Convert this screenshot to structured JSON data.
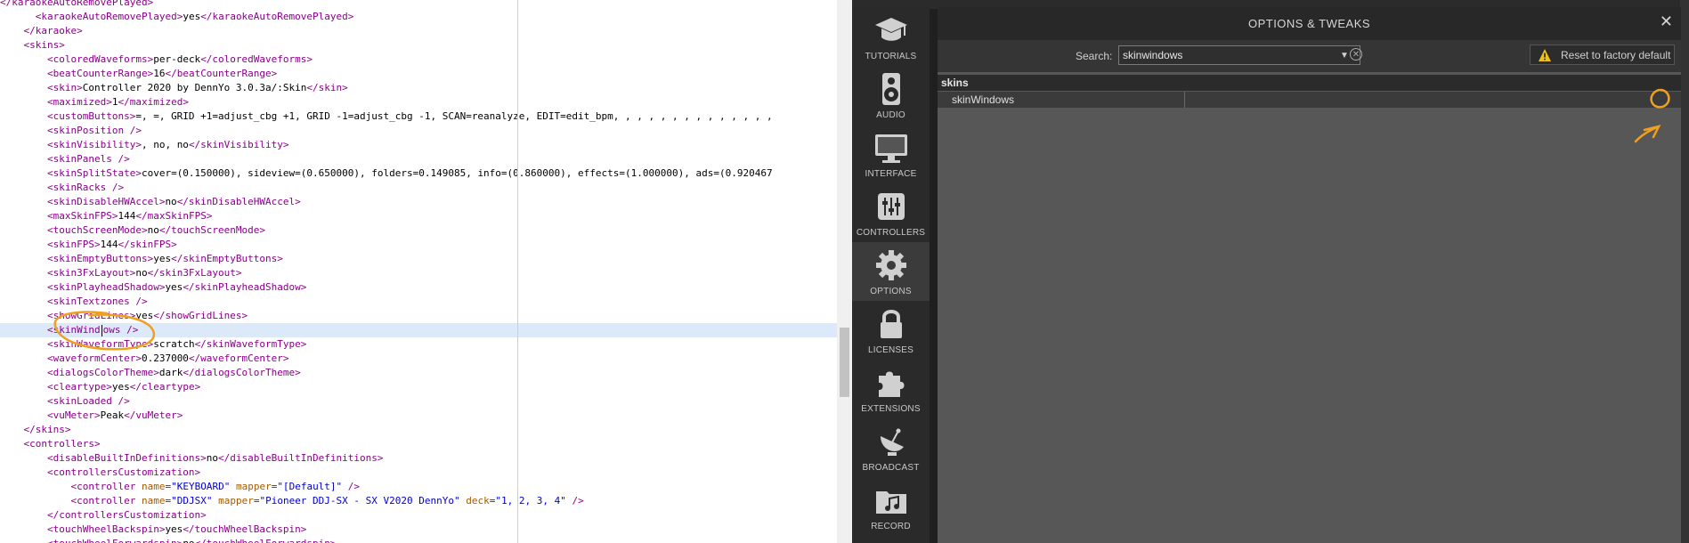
{
  "editor": {
    "lines": [
      [
        {
          "c": "t",
          "s": "</karaokeAutoRemovePlayed>"
        }
      ],
      [
        {
          "c": "x",
          "s": "      "
        },
        {
          "c": "t",
          "s": "<karaokeAutoRemovePlayed>"
        },
        {
          "c": "x",
          "s": "yes"
        },
        {
          "c": "t",
          "s": "</karaokeAutoRemovePlayed>"
        }
      ],
      [
        {
          "c": "x",
          "s": "    "
        },
        {
          "c": "t",
          "s": "</karaoke>"
        }
      ],
      [
        {
          "c": "x",
          "s": "    "
        },
        {
          "c": "t",
          "s": "<skins>"
        }
      ],
      [
        {
          "c": "x",
          "s": "        "
        },
        {
          "c": "t",
          "s": "<coloredWaveforms>"
        },
        {
          "c": "x",
          "s": "per-deck"
        },
        {
          "c": "t",
          "s": "</coloredWaveforms>"
        }
      ],
      [
        {
          "c": "x",
          "s": "        "
        },
        {
          "c": "t",
          "s": "<beatCounterRange>"
        },
        {
          "c": "x",
          "s": "16"
        },
        {
          "c": "t",
          "s": "</beatCounterRange>"
        }
      ],
      [
        {
          "c": "x",
          "s": "        "
        },
        {
          "c": "t",
          "s": "<skin>"
        },
        {
          "c": "x",
          "s": "Controller 2020 by DennYo 3.0.3a/:Skin"
        },
        {
          "c": "t",
          "s": "</skin>"
        }
      ],
      [
        {
          "c": "x",
          "s": "        "
        },
        {
          "c": "t",
          "s": "<maximized>"
        },
        {
          "c": "x",
          "s": "1"
        },
        {
          "c": "t",
          "s": "</maximized>"
        }
      ],
      [
        {
          "c": "x",
          "s": "        "
        },
        {
          "c": "t",
          "s": "<customButtons>"
        },
        {
          "c": "x",
          "s": "=, =, GRID +1=adjust_cbg +1, GRID -1=adjust_cbg -1, SCAN=reanalyze, EDIT=edit_bpm, , , , , , , , , , , , , ,"
        }
      ],
      [
        {
          "c": "x",
          "s": "        "
        },
        {
          "c": "t",
          "s": "<skinPosition />"
        }
      ],
      [
        {
          "c": "x",
          "s": "        "
        },
        {
          "c": "t",
          "s": "<skinVisibility>"
        },
        {
          "c": "x",
          "s": ", no, no"
        },
        {
          "c": "t",
          "s": "</skinVisibility>"
        }
      ],
      [
        {
          "c": "x",
          "s": "        "
        },
        {
          "c": "t",
          "s": "<skinPanels />"
        }
      ],
      [
        {
          "c": "x",
          "s": "        "
        },
        {
          "c": "t",
          "s": "<skinSplitState>"
        },
        {
          "c": "x",
          "s": "cover=(0.150000), sideview=(0.650000), folders=0.149085, info=(0.860000), effects=(1.000000), ads=(0.920467"
        }
      ],
      [
        {
          "c": "x",
          "s": "        "
        },
        {
          "c": "t",
          "s": "<skinRacks />"
        }
      ],
      [
        {
          "c": "x",
          "s": "        "
        },
        {
          "c": "t",
          "s": "<skinDisableHWAccel>"
        },
        {
          "c": "x",
          "s": "no"
        },
        {
          "c": "t",
          "s": "</skinDisableHWAccel>"
        }
      ],
      [
        {
          "c": "x",
          "s": "        "
        },
        {
          "c": "t",
          "s": "<maxSkinFPS>"
        },
        {
          "c": "x",
          "s": "144"
        },
        {
          "c": "t",
          "s": "</maxSkinFPS>"
        }
      ],
      [
        {
          "c": "x",
          "s": "        "
        },
        {
          "c": "t",
          "s": "<touchScreenMode>"
        },
        {
          "c": "x",
          "s": "no"
        },
        {
          "c": "t",
          "s": "</touchScreenMode>"
        }
      ],
      [
        {
          "c": "x",
          "s": "        "
        },
        {
          "c": "t",
          "s": "<skinFPS>"
        },
        {
          "c": "x",
          "s": "144"
        },
        {
          "c": "t",
          "s": "</skinFPS>"
        }
      ],
      [
        {
          "c": "x",
          "s": "        "
        },
        {
          "c": "t",
          "s": "<skinEmptyButtons>"
        },
        {
          "c": "x",
          "s": "yes"
        },
        {
          "c": "t",
          "s": "</skinEmptyButtons>"
        }
      ],
      [
        {
          "c": "x",
          "s": "        "
        },
        {
          "c": "t",
          "s": "<skin3FxLayout>"
        },
        {
          "c": "x",
          "s": "no"
        },
        {
          "c": "t",
          "s": "</skin3FxLayout>"
        }
      ],
      [
        {
          "c": "x",
          "s": "        "
        },
        {
          "c": "t",
          "s": "<skinPlayheadShadow>"
        },
        {
          "c": "x",
          "s": "yes"
        },
        {
          "c": "t",
          "s": "</skinPlayheadShadow>"
        }
      ],
      [
        {
          "c": "x",
          "s": "        "
        },
        {
          "c": "t",
          "s": "<skinTextzones />"
        }
      ],
      [
        {
          "c": "x",
          "s": "        "
        },
        {
          "c": "t",
          "s": "<showGridLines>"
        },
        {
          "c": "x",
          "s": "yes"
        },
        {
          "c": "t",
          "s": "</showGridLines>"
        }
      ],
      [
        {
          "c": "x",
          "s": "        "
        },
        {
          "c": "t",
          "s": "<skinWind"
        },
        {
          "c": "caret",
          "s": ""
        },
        {
          "c": "t",
          "s": "ows />"
        }
      ],
      [
        {
          "c": "x",
          "s": "        "
        },
        {
          "c": "t",
          "s": "<skinWaveformType>"
        },
        {
          "c": "x",
          "s": "scratch"
        },
        {
          "c": "t",
          "s": "</skinWaveformType>"
        }
      ],
      [
        {
          "c": "x",
          "s": "        "
        },
        {
          "c": "t",
          "s": "<waveformCenter>"
        },
        {
          "c": "x",
          "s": "0.237000"
        },
        {
          "c": "t",
          "s": "</waveformCenter>"
        }
      ],
      [
        {
          "c": "x",
          "s": "        "
        },
        {
          "c": "t",
          "s": "<dialogsColorTheme>"
        },
        {
          "c": "x",
          "s": "dark"
        },
        {
          "c": "t",
          "s": "</dialogsColorTheme>"
        }
      ],
      [
        {
          "c": "x",
          "s": "        "
        },
        {
          "c": "t",
          "s": "<cleartype>"
        },
        {
          "c": "x",
          "s": "yes"
        },
        {
          "c": "t",
          "s": "</cleartype>"
        }
      ],
      [
        {
          "c": "x",
          "s": "        "
        },
        {
          "c": "t",
          "s": "<skinLoaded />"
        }
      ],
      [
        {
          "c": "x",
          "s": "        "
        },
        {
          "c": "t",
          "s": "<vuMeter>"
        },
        {
          "c": "x",
          "s": "Peak"
        },
        {
          "c": "t",
          "s": "</vuMeter>"
        }
      ],
      [
        {
          "c": "x",
          "s": "    "
        },
        {
          "c": "t",
          "s": "</skins>"
        }
      ],
      [
        {
          "c": "x",
          "s": "    "
        },
        {
          "c": "t",
          "s": "<controllers>"
        }
      ],
      [
        {
          "c": "x",
          "s": "        "
        },
        {
          "c": "t",
          "s": "<disableBuiltInDefinitions>"
        },
        {
          "c": "x",
          "s": "no"
        },
        {
          "c": "t",
          "s": "</disableBuiltInDefinitions>"
        }
      ],
      [
        {
          "c": "x",
          "s": "        "
        },
        {
          "c": "t",
          "s": "<controllersCustomization>"
        }
      ],
      [
        {
          "c": "x",
          "s": "            "
        },
        {
          "c": "t",
          "s": "<controller "
        },
        {
          "c": "an",
          "s": "name"
        },
        {
          "c": "t",
          "s": "="
        },
        {
          "c": "av",
          "s": "\"KEYBOARD\""
        },
        {
          "c": "x",
          "s": " "
        },
        {
          "c": "an",
          "s": "mapper"
        },
        {
          "c": "t",
          "s": "="
        },
        {
          "c": "av",
          "s": "\"[Default]\""
        },
        {
          "c": "t",
          "s": " />"
        }
      ],
      [
        {
          "c": "x",
          "s": "            "
        },
        {
          "c": "t",
          "s": "<controller "
        },
        {
          "c": "an",
          "s": "name"
        },
        {
          "c": "t",
          "s": "="
        },
        {
          "c": "av",
          "s": "\"DDJSX\""
        },
        {
          "c": "x",
          "s": " "
        },
        {
          "c": "an",
          "s": "mapper"
        },
        {
          "c": "t",
          "s": "="
        },
        {
          "c": "av",
          "s": "\"Pioneer DDJ-SX - SX V2020 DennYo\""
        },
        {
          "c": "x",
          "s": " "
        },
        {
          "c": "an",
          "s": "deck"
        },
        {
          "c": "t",
          "s": "="
        },
        {
          "c": "av",
          "s": "\"1, 2, 3, 4\""
        },
        {
          "c": "t",
          "s": " />"
        }
      ],
      [
        {
          "c": "x",
          "s": "        "
        },
        {
          "c": "t",
          "s": "</controllersCustomization>"
        }
      ],
      [
        {
          "c": "x",
          "s": "        "
        },
        {
          "c": "t",
          "s": "<touchWheelBackspin>"
        },
        {
          "c": "x",
          "s": "yes"
        },
        {
          "c": "t",
          "s": "</touchWheelBackspin>"
        }
      ],
      [
        {
          "c": "x",
          "s": "        "
        },
        {
          "c": "t",
          "s": "<touchWheelForwardspin>"
        },
        {
          "c": "x",
          "s": "no"
        },
        {
          "c": "t",
          "s": "</touchWheelForwardspin>"
        }
      ]
    ],
    "highlight_line": 23
  },
  "sidebar": {
    "items": [
      {
        "label": "TUTORIALS",
        "icon": "mortarboard-icon"
      },
      {
        "label": "AUDIO",
        "icon": "speaker-icon"
      },
      {
        "label": "INTERFACE",
        "icon": "monitor-icon"
      },
      {
        "label": "CONTROLLERS",
        "icon": "sliders-icon"
      },
      {
        "label": "OPTIONS",
        "icon": "gear-icon",
        "active": true
      },
      {
        "label": "LICENSES",
        "icon": "lock-icon"
      },
      {
        "label": "EXTENSIONS",
        "icon": "puzzle-icon"
      },
      {
        "label": "BROADCAST",
        "icon": "satellite-dish-icon"
      },
      {
        "label": "RECORD",
        "icon": "music-folder-icon"
      }
    ]
  },
  "dialog": {
    "title": "OPTIONS & TWEAKS",
    "close": "✕",
    "search_label": "Search:",
    "search_value": "skinwindows",
    "reset_label": "Reset to factory default",
    "group": "skins",
    "option_name": "skinWindows",
    "option_value": ""
  },
  "colors": {
    "tag": "#8b008b",
    "attr_name": "#a55a00",
    "attr_value": "#0000d0",
    "annotation": "#f0a020",
    "highlight": "#dbe9f9"
  }
}
